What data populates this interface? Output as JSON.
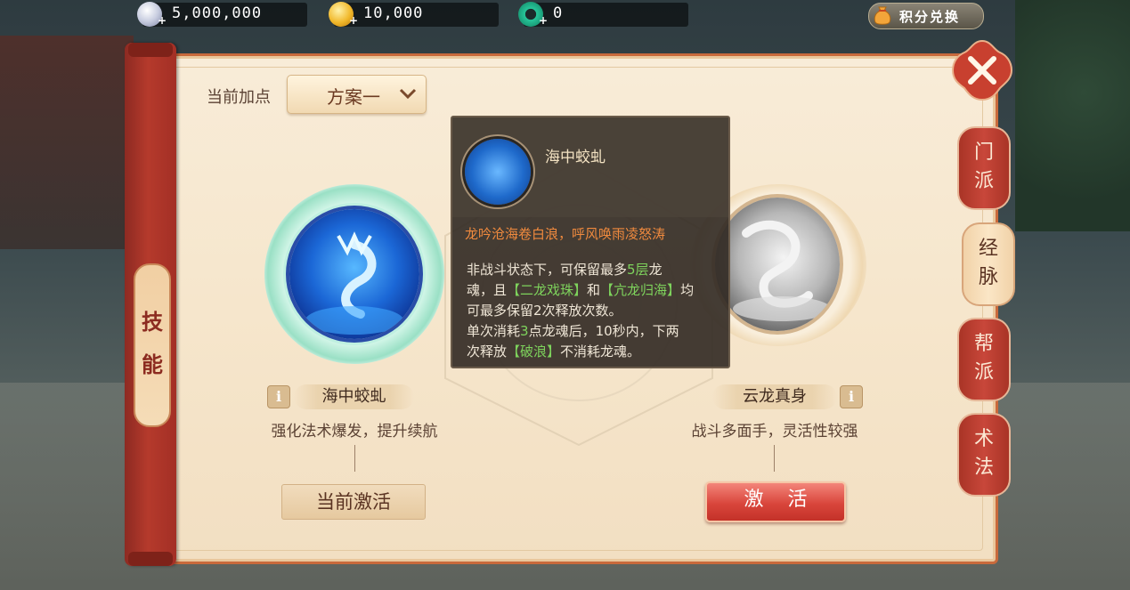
{
  "currencies": [
    {
      "icon": "silver-coin-icon",
      "value": "5,000,000"
    },
    {
      "icon": "gold-coin-icon",
      "value": "10,000"
    },
    {
      "icon": "jade-icon",
      "value": "0"
    }
  ],
  "exchange": {
    "label": "积分兑换",
    "icon": "money-bag-icon"
  },
  "left_tab": {
    "chars": [
      "技",
      "能"
    ]
  },
  "plan": {
    "label": "当前加点",
    "selected": "方案一"
  },
  "skills": [
    {
      "name": "海中蛟虬",
      "desc": "强化法术爆发，提升续航",
      "button": "当前激活",
      "state": "active"
    },
    {
      "name": "云龙真身",
      "desc": "战斗多面手，灵活性较强",
      "button": "激 活",
      "state": "inactive"
    }
  ],
  "tooltip": {
    "title": "海中蛟虬",
    "subtitle": "龙吟沧海卷白浪，呼风唤雨凌怒涛",
    "body": {
      "l1a": "非战斗状态下，可保留最多",
      "l1b": "5层",
      "l1c": "龙",
      "l2a": "魂，且",
      "l2b": "【二龙戏珠】",
      "l2c": "和",
      "l2d": "【亢龙归海】",
      "l2e": "均",
      "l3": "可最多保留2次释放次数。",
      "l4a": "单次消耗",
      "l4b": "3",
      "l4c": "点龙魂后，10秒内，下两",
      "l5a": "次释放",
      "l5b": "【破浪】",
      "l5c": "不消耗龙魂。"
    }
  },
  "side_tabs": [
    {
      "label": "门派",
      "active": false
    },
    {
      "label": "经脉",
      "active": true
    },
    {
      "label": "帮派",
      "active": false
    },
    {
      "label": "术法",
      "active": false
    }
  ],
  "colors": {
    "accent_red": "#c33128",
    "panel": "#f6e6cc",
    "highlight_green": "#7ed35c",
    "subtitle_orange": "#f08a3e"
  }
}
